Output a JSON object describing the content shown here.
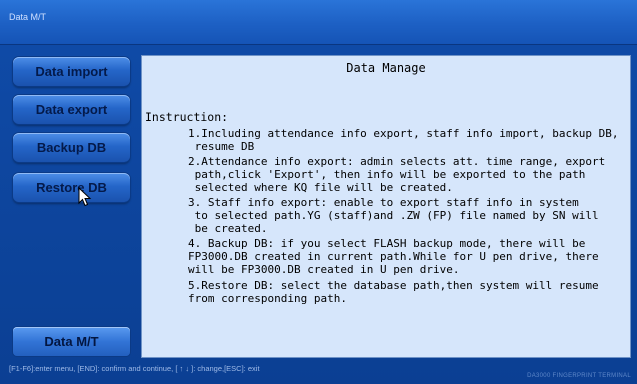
{
  "window": {
    "title": "Data M/T"
  },
  "sidebar": {
    "buttons": [
      {
        "label": "Data import"
      },
      {
        "label": "Data export"
      },
      {
        "label": "Backup DB"
      },
      {
        "label": "Restore DB"
      }
    ],
    "bottom_button": {
      "label": "Data M/T"
    }
  },
  "panel": {
    "title": "Data Manage",
    "instruction_heading": "Instruction:",
    "items": [
      "1.Including attendance info export, staff info import, backup DB,\n resume DB",
      "2.Attendance info export: admin selects att. time range, export\n path,click 'Export', then info will be exported to the path\n selected where KQ file will be created.",
      "3. Staff info export: enable to export staff info in system\n to selected path.YG (staff)and .ZW (FP) file named by SN will\n be created.",
      "4. Backup DB: if you select FLASH backup mode, there will be\nFP3000.DB created in current path.While for U pen drive, there\nwill be FP3000.DB created in U pen drive.",
      "5.Restore DB: select the database path,then system will resume\nfrom corresponding path."
    ]
  },
  "statusbar": {
    "hint": "[F1-F6]:enter menu, [END]: confirm and continue, [ ↑ ↓ ]: change,[ESC]: exit",
    "brand": "DA3000 FINGERPRINT TERMINAL"
  }
}
